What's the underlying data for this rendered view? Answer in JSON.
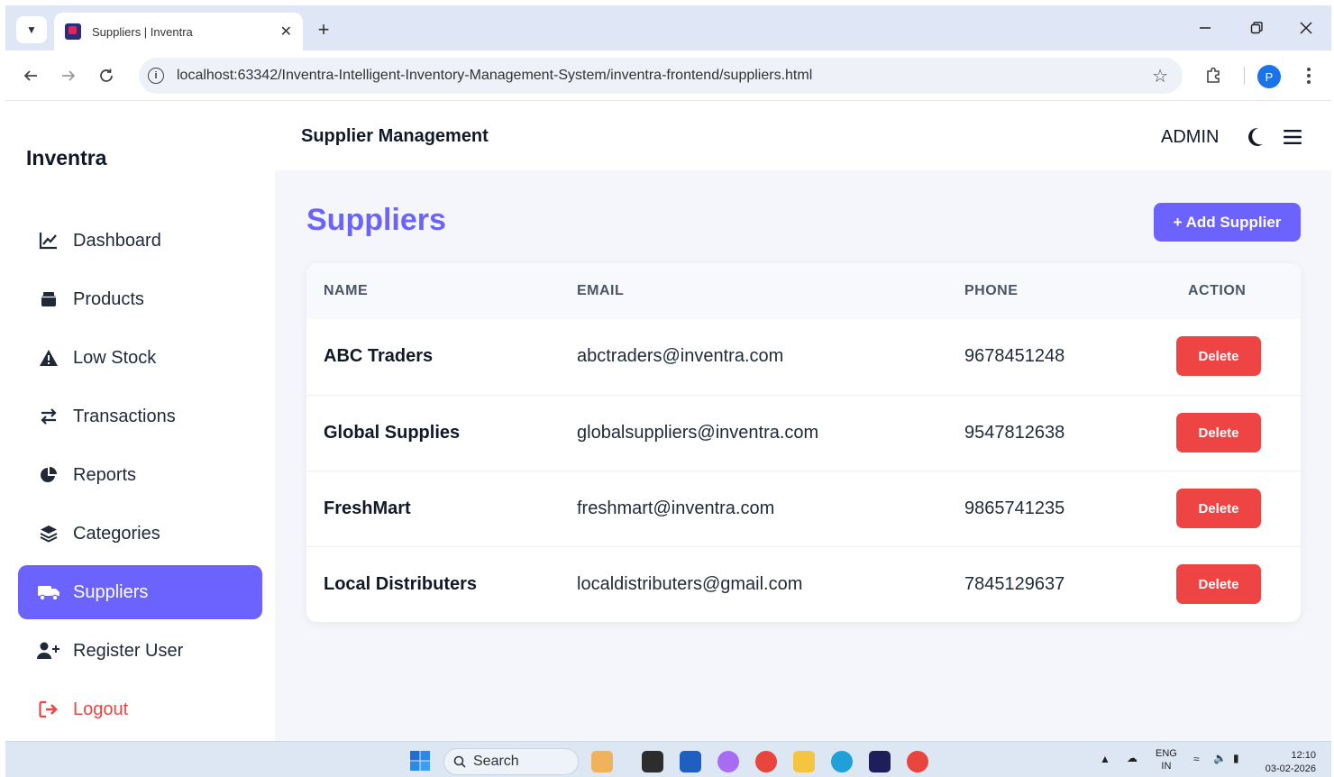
{
  "browser": {
    "tab_title": "Suppliers | Inventra",
    "tab_close": "✕",
    "new_tab": "+",
    "url": "localhost:63342/Inventra-Intelligent-Inventory-Management-System/inventra-frontend/suppliers.html",
    "profile_initial": "P"
  },
  "sidebar": {
    "brand": "Inventra",
    "items": [
      {
        "label": "Dashboard",
        "icon": "chart-line-icon"
      },
      {
        "label": "Products",
        "icon": "box-icon"
      },
      {
        "label": "Low Stock",
        "icon": "warning-icon"
      },
      {
        "label": "Transactions",
        "icon": "exchange-icon"
      },
      {
        "label": "Reports",
        "icon": "pie-chart-icon"
      },
      {
        "label": "Categories",
        "icon": "layers-icon"
      },
      {
        "label": "Suppliers",
        "icon": "truck-icon",
        "active": true
      },
      {
        "label": "Register User",
        "icon": "user-plus-icon"
      },
      {
        "label": "Logout",
        "icon": "logout-icon"
      }
    ]
  },
  "topbar": {
    "title": "Supplier Management",
    "user": "ADMIN"
  },
  "main": {
    "section_title": "Suppliers",
    "add_button": "+ Add Supplier"
  },
  "table": {
    "headers": [
      "NAME",
      "EMAIL",
      "PHONE",
      "ACTION"
    ],
    "rows": [
      {
        "name": "ABC Traders",
        "email": "abctraders@inventra.com",
        "phone": "9678451248",
        "action": "Delete"
      },
      {
        "name": "Global Supplies",
        "email": "globalsuppliers@inventra.com",
        "phone": "9547812638",
        "action": "Delete"
      },
      {
        "name": "FreshMart",
        "email": "freshmart@inventra.com",
        "phone": "9865741235",
        "action": "Delete"
      },
      {
        "name": "Local Distributers",
        "email": "localdistributers@gmail.com",
        "phone": "7845129637",
        "action": "Delete"
      }
    ]
  },
  "taskbar": {
    "search": "Search",
    "lang": "ENG",
    "region": "IN",
    "time": "12:10",
    "date": "03-02-2026"
  },
  "colors": {
    "accent": "#6c63ff",
    "danger": "#ef4444"
  }
}
